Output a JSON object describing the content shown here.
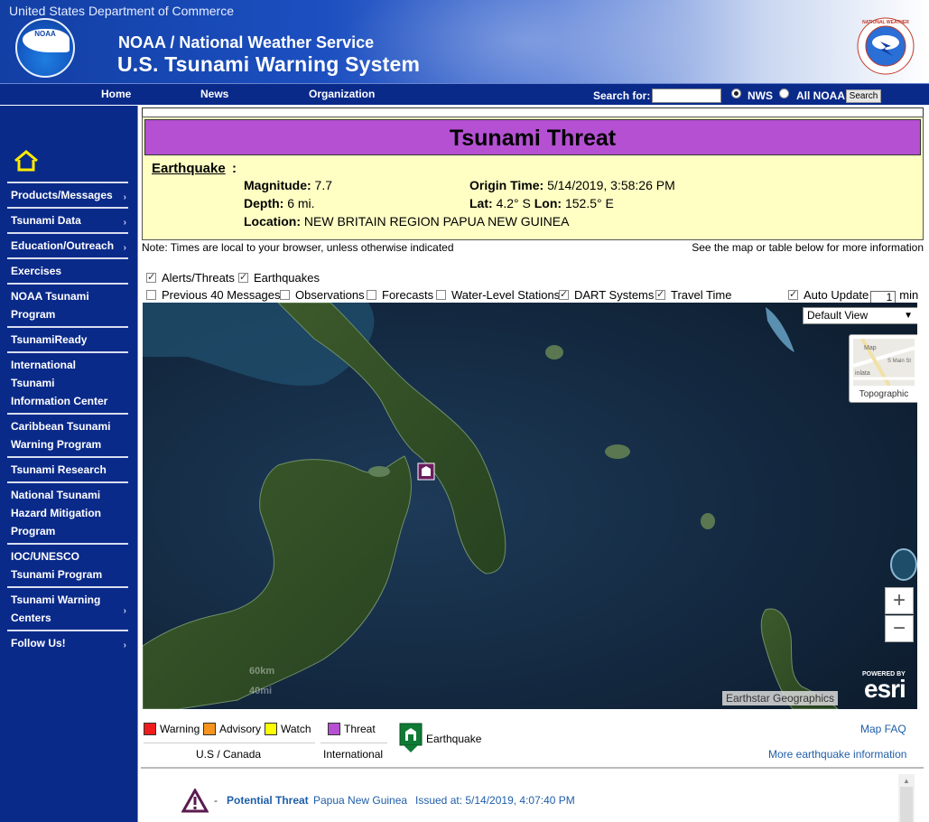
{
  "header": {
    "department": "United States Department of Commerce",
    "line1": "NOAA / National Weather Service",
    "line2": "U.S. Tsunami Warning System",
    "noaa_logo_text": "NOAA",
    "nws_logo_text": "NATIONAL WEATHER SERVICE"
  },
  "topnav": {
    "items": [
      "Home",
      "News",
      "Organization"
    ],
    "search_label": "Search for:",
    "search_value": "",
    "radio_nws": "NWS",
    "radio_all": "All NOAA",
    "search_button": "Search",
    "selected_radio": "NWS"
  },
  "sidebar": {
    "home_icon": "home-icon",
    "items": [
      {
        "label": "Products/Messages",
        "arrow": true
      },
      {
        "label": "Tsunami Data",
        "arrow": true
      },
      {
        "label": "Education/Outreach",
        "arrow": true
      },
      {
        "label": "Exercises",
        "arrow": false
      },
      {
        "label": "NOAA Tsunami Program",
        "arrow": false
      },
      {
        "label": "TsunamiReady",
        "arrow": false
      },
      {
        "label": "International Tsunami Information Center",
        "arrow": false
      },
      {
        "label": "Caribbean Tsunami Warning Program",
        "arrow": false
      },
      {
        "label": "Tsunami Research",
        "arrow": false
      },
      {
        "label": "National Tsunami Hazard Mitigation Program",
        "arrow": false
      },
      {
        "label": "IOC/UNESCO Tsunami Program",
        "arrow": false
      },
      {
        "label": "Tsunami Warning Centers",
        "arrow": true
      },
      {
        "label": "Follow Us!",
        "arrow": true
      }
    ]
  },
  "threat": {
    "title": "Tsunami Threat",
    "title_color": "#b550d3",
    "box_color": "#ffffc4",
    "earthquake_label": "Earthquake",
    "colon": ":",
    "magnitude_label": "Magnitude:",
    "magnitude": "7.7",
    "depth_label": "Depth:",
    "depth": "6 mi.",
    "location_label": "Location:",
    "location": "NEW BRITAIN REGION PAPUA NEW GUINEA",
    "origin_label": "Origin Time:",
    "origin_time": "5/14/2019, 3:58:26 PM",
    "lat_label": "Lat:",
    "lat": "4.2° S",
    "lon_label": "Lon:",
    "lon": "152.5° E"
  },
  "notes": {
    "left": "Note: Times are local to your browser, unless otherwise indicated",
    "right": "See the map or table below for more information"
  },
  "layers": {
    "row1": [
      {
        "label": "Alerts/Threats",
        "checked": true
      },
      {
        "label": "Earthquakes",
        "checked": true
      }
    ],
    "row2": [
      {
        "label": "Previous 40 Messages",
        "checked": false
      },
      {
        "label": "Observations",
        "checked": false
      },
      {
        "label": "Forecasts",
        "checked": false
      },
      {
        "label": "Water-Level Stations",
        "checked": false
      },
      {
        "label": "DART Systems",
        "checked": true
      },
      {
        "label": "Travel Time",
        "checked": true
      }
    ],
    "auto_update_label": "Auto Update",
    "auto_update_checked": true,
    "auto_update_value": "1",
    "auto_update_unit": "min"
  },
  "map": {
    "view_select": "Default View",
    "basemap_label": "Topographic",
    "zoom_in": "+",
    "zoom_out": "−",
    "attribution": "Earthstar Geographics",
    "powered_by": "POWERED BY",
    "esri": "esri",
    "scale_km": "60km",
    "scale_mi": "40mi",
    "tile_labels": [
      "Map",
      "inlata",
      "S Main St"
    ]
  },
  "legend": {
    "warning": {
      "label": "Warning",
      "color": "#ee1c1c"
    },
    "advisory": {
      "label": "Advisory",
      "color": "#f7941d"
    },
    "watch": {
      "label": "Watch",
      "color": "#ffff00"
    },
    "threat": {
      "label": "Threat",
      "color": "#b550d3"
    },
    "us_canada": "U.S / Canada",
    "international": "International",
    "earthquake": "Earthquake",
    "map_faq": "Map FAQ",
    "more_eq": "More earthquake information"
  },
  "messages": [
    {
      "dash": "-",
      "type": "Potential Threat",
      "region": "Papua New Guinea",
      "issued": "Issued at: 5/14/2019, 4:07:40 PM"
    }
  ]
}
